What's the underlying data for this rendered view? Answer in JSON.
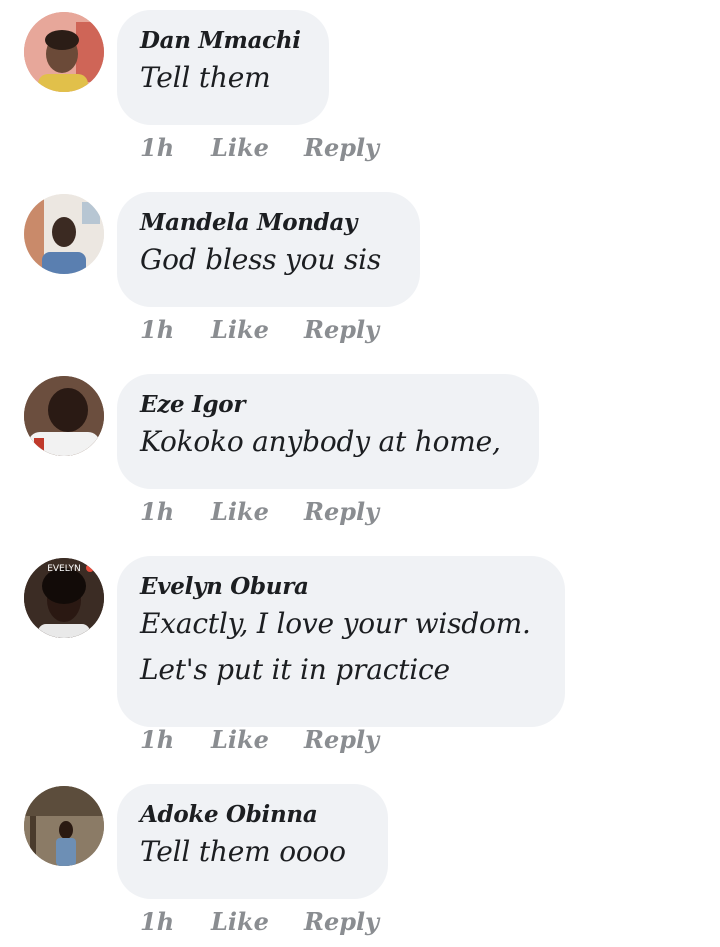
{
  "comments": [
    {
      "author": "Dan Mmachi",
      "lines": [
        "Tell them"
      ],
      "time": "1h",
      "like": "Like",
      "reply": "Reply"
    },
    {
      "author": "Mandela Monday",
      "lines": [
        "God bless you sis"
      ],
      "time": "1h",
      "like": "Like",
      "reply": "Reply"
    },
    {
      "author": "Eze Igor",
      "lines": [
        "Kokoko anybody at home,"
      ],
      "time": "1h",
      "like": "Like",
      "reply": "Reply"
    },
    {
      "author": "Evelyn Obura",
      "lines": [
        "Exactly, I love your wisdom.",
        "Let's put it in practice"
      ],
      "time": "1h",
      "like": "Like",
      "reply": "Reply",
      "avatar_badge": "EVELYN"
    },
    {
      "author": "Adoke Obinna",
      "lines": [
        "Tell them oooo"
      ],
      "time": "1h",
      "like": "Like",
      "reply": "Reply"
    }
  ],
  "colors": {
    "bubble": "#f0f2f5",
    "text": "#1c1e21",
    "meta": "#8a8d91"
  }
}
